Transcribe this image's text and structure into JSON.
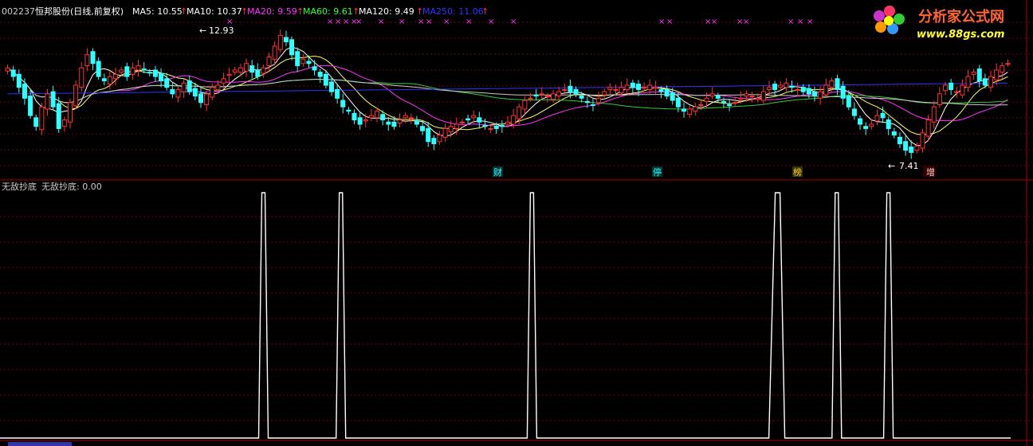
{
  "header": {
    "code": "002237",
    "name": "恒邦股份(日线,前复权)",
    "ma_items": [
      {
        "label": "MA5: 10.55",
        "color": "#ffffff"
      },
      {
        "label": "MA10: 10.37",
        "color": "#ffffff"
      },
      {
        "label": "MA20: 9.59",
        "color": "#ff33ff"
      },
      {
        "label": "MA60: 9.61",
        "color": "#33ff33"
      },
      {
        "label": "MA120: 9.49",
        "color": "#ffffff"
      },
      {
        "label": "MA250: 11.06",
        "color": "#3333ff"
      }
    ],
    "arrow": "↑"
  },
  "logo": {
    "title": "分析家公式网",
    "url": "www.88gs.com"
  },
  "indicator": {
    "title": "无敌抄底",
    "value_label": "无敌抄底: 0.00"
  },
  "colors": {
    "up": "#ff3333",
    "down": "#33ffff",
    "ma5": "#ffffff",
    "ma10": "#ffff66",
    "ma20": "#ff33ff",
    "ma60": "#33cc33",
    "ma120": "#cccccc",
    "ma250": "#3333ff",
    "signal": "#ffffff",
    "grid": "#7a0000",
    "cross": "#ff33ff"
  },
  "price_annotations": [
    {
      "label": "12.93",
      "price": 12.93
    },
    {
      "label": "7.41",
      "price": 7.41
    }
  ],
  "event_markers": [
    "财",
    "停",
    "榜",
    "增"
  ],
  "chart_data": {
    "type": "candlestick",
    "price_range": [
      7.0,
      13.5
    ],
    "candles_close": [
      11.4,
      11.0,
      10.5,
      10.0,
      9.2,
      8.7,
      9.6,
      10.2,
      9.6,
      8.6,
      9.0,
      9.8,
      10.6,
      11.4,
      12.0,
      11.6,
      11.0,
      10.8,
      11.0,
      11.1,
      11.3,
      11.0,
      11.4,
      11.5,
      11.3,
      11.2,
      11.0,
      10.8,
      10.5,
      10.2,
      10.4,
      10.7,
      10.3,
      10.1,
      9.8,
      10.2,
      10.5,
      10.6,
      10.9,
      11.1,
      11.3,
      11.4,
      11.6,
      11.2,
      11.0,
      11.4,
      11.9,
      12.4,
      12.9,
      12.6,
      12.0,
      11.5,
      11.8,
      11.6,
      11.3,
      11.0,
      10.6,
      10.3,
      10.0,
      9.6,
      9.4,
      9.0,
      8.8,
      9.0,
      9.2,
      9.4,
      9.0,
      8.8,
      8.7,
      9.0,
      9.2,
      9.1,
      8.8,
      8.5,
      8.0,
      7.9,
      8.3,
      8.6,
      8.7,
      8.8,
      8.9,
      9.0,
      9.2,
      8.9,
      8.7,
      8.6,
      8.6,
      8.7,
      8.9,
      9.2,
      9.6,
      9.9,
      10.0,
      10.1,
      10.2,
      10.1,
      10.2,
      10.3,
      10.4,
      10.3,
      10.2,
      10.0,
      9.8,
      9.7,
      10.0,
      10.3,
      10.5,
      10.4,
      10.5,
      10.6,
      10.5,
      10.4,
      10.5,
      10.6,
      10.5,
      10.3,
      10.1,
      9.9,
      9.6,
      9.4,
      9.5,
      9.6,
      9.7,
      10.0,
      10.2,
      10.0,
      9.8,
      9.7,
      9.8,
      10.0,
      10.2,
      10.1,
      10.0,
      10.3,
      10.5,
      10.4,
      10.6,
      10.7,
      10.5,
      10.4,
      10.3,
      10.2,
      10.1,
      10.3,
      10.6,
      10.8,
      10.4,
      10.0,
      9.6,
      9.2,
      8.8,
      8.6,
      8.8,
      9.2,
      9.1,
      8.6,
      8.3,
      7.9,
      7.6,
      7.5,
      7.8,
      8.4,
      9.0,
      9.6,
      10.2,
      10.6,
      10.4,
      10.3,
      10.6,
      11.0,
      11.2,
      10.8,
      10.6,
      11.0,
      11.3,
      11.5,
      11.6
    ],
    "ma_lines": [
      "MA5",
      "MA10",
      "MA20",
      "MA60",
      "MA120",
      "MA250"
    ],
    "signal_spikes": [
      0.255,
      0.33,
      0.515,
      0.752,
      0.81,
      0.86
    ],
    "signal_range": [
      0,
      1
    ]
  }
}
